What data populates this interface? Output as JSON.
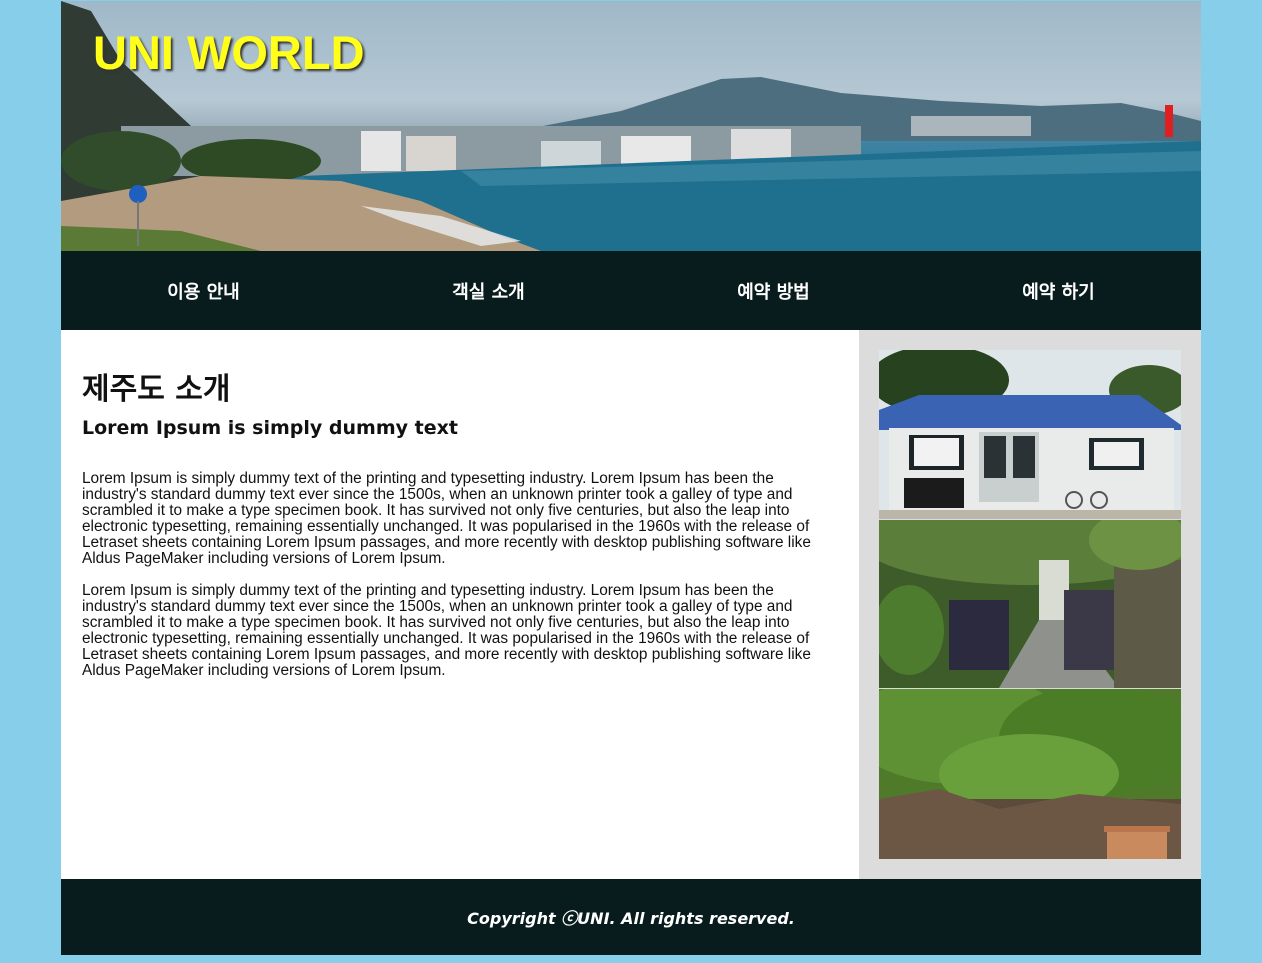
{
  "header": {
    "logo": "UNI WORLD",
    "banner_image": "jeju-coastline-photo"
  },
  "nav": {
    "items": [
      {
        "label": "이용 안내"
      },
      {
        "label": "객실 소개"
      },
      {
        "label": "예약 방법"
      },
      {
        "label": "예약 하기"
      }
    ]
  },
  "main": {
    "title": "제주도 소개",
    "subtitle": "Lorem Ipsum is simply dummy text",
    "paragraphs": [
      "Lorem Ipsum is simply dummy text of the printing and typesetting industry. Lorem Ipsum has been the industry's standard dummy text ever since the 1500s, when an unknown printer took a galley of type and scrambled it to make a type specimen book. It has survived not only five centuries, but also the leap into electronic typesetting, remaining essentially unchanged. It was popularised in the 1960s with the release of Letraset sheets containing Lorem Ipsum passages, and more recently with desktop publishing software like Aldus PageMaker including versions of Lorem Ipsum.",
      "Lorem Ipsum is simply dummy text of the printing and typesetting industry. Lorem Ipsum has been the industry's standard dummy text ever since the 1500s, when an unknown printer took a galley of type and scrambled it to make a type specimen book. It has survived not only five centuries, but also the leap into electronic typesetting, remaining essentially unchanged. It was popularised in the 1960s with the release of Letraset sheets containing Lorem Ipsum passages, and more recently with desktop publishing software like Aldus PageMaker including versions of Lorem Ipsum."
    ]
  },
  "sidebar": {
    "photos": [
      "blue-roof-house-photo",
      "stone-wall-alley-photo",
      "garden-shrubs-photo"
    ]
  },
  "footer": {
    "copyright": "Copyright ⓒUNI. All rights reserved."
  },
  "colors": {
    "page_bg": "#87ceeb",
    "dark_bar": "#081c1d",
    "logo": "#ffff1a",
    "sidebar_bg": "#dcdcdc"
  }
}
